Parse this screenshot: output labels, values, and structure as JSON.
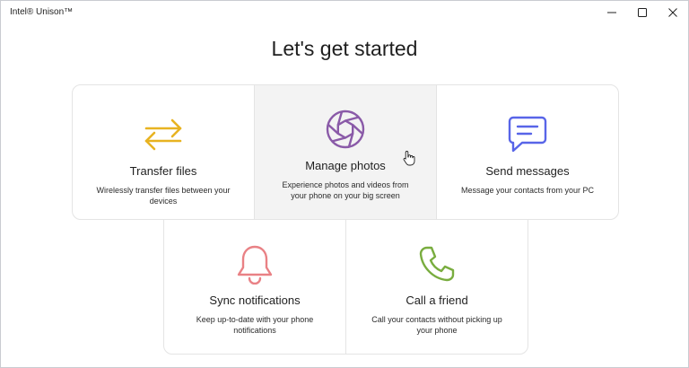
{
  "window": {
    "title": "Intel® Unison™"
  },
  "heading": "Let's get started",
  "cards": {
    "transfer": {
      "title": "Transfer files",
      "description": "Wirelessly transfer files between your devices",
      "icon": "transfer-arrows-icon",
      "color": "#e8b321"
    },
    "photos": {
      "title": "Manage photos",
      "description": "Experience photos and videos from your phone on your big screen",
      "icon": "camera-aperture-icon",
      "color": "#8a5aa8"
    },
    "messages": {
      "title": "Send messages",
      "description": "Message your contacts from your PC",
      "icon": "chat-bubble-icon",
      "color": "#5865e8"
    },
    "notifications": {
      "title": "Sync notifications",
      "description": "Keep up-to-date with your phone notifications",
      "icon": "bell-icon",
      "color": "#e98185"
    },
    "call": {
      "title": "Call a friend",
      "description": "Call your contacts without picking up your phone",
      "icon": "phone-icon",
      "color": "#79ad3f"
    }
  }
}
